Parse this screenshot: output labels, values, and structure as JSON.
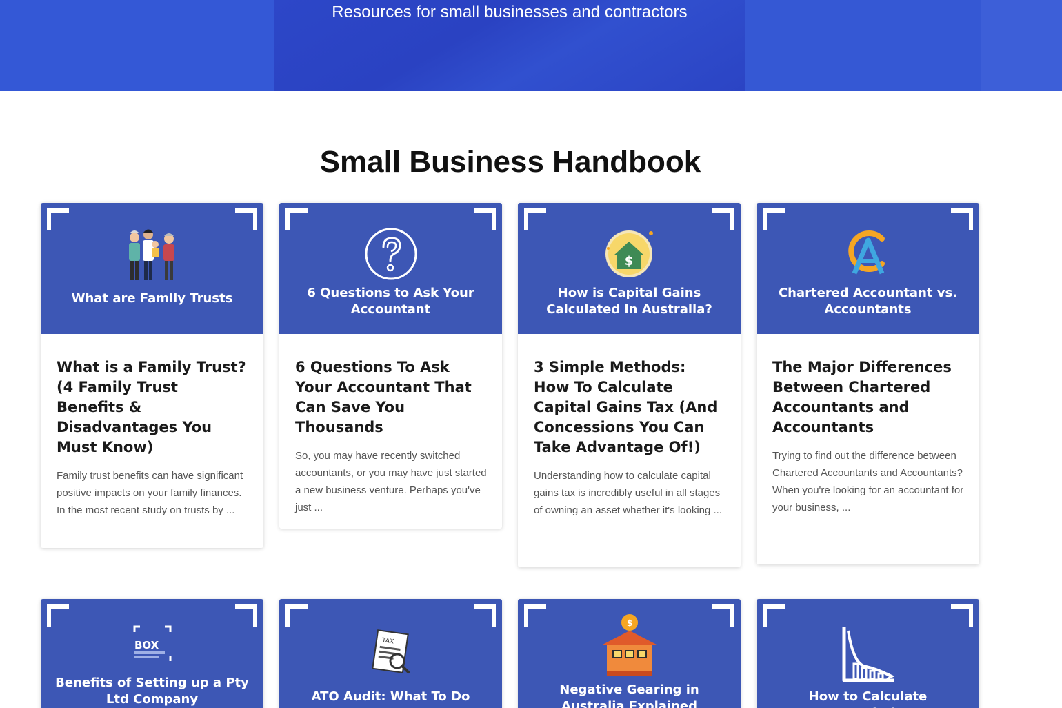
{
  "hero": {
    "subtitle": "Resources for small businesses and contractors"
  },
  "section": {
    "title": "Small Business Handbook"
  },
  "cards": [
    {
      "thumb_label": "What are Family Trusts",
      "title": "What is a Family Trust? (4 Family Trust Benefits & Disadvantages You Must Know)",
      "excerpt": "Family trust benefits can have significant positive impacts on your family finances. In the most recent study on trusts by ...",
      "icon": "family-icon"
    },
    {
      "thumb_label": "6 Questions to Ask Your Accountant",
      "title": "6 Questions To Ask Your Accountant That Can Save You Thousands",
      "excerpt": "So, you may have recently switched accountants, or you may have just started a new business venture. Perhaps you've just ...",
      "icon": "question-icon"
    },
    {
      "thumb_label": "How is Capital Gains Calculated in Australia?",
      "title": "3 Simple Methods: How To Calculate Capital Gains Tax (And Concessions You Can Take Advantage Of!)",
      "excerpt": "Understanding how to calculate capital gains tax is incredibly useful in all stages of owning an asset whether it's looking ...",
      "icon": "house-dollar-icon"
    },
    {
      "thumb_label": "Chartered Accountant vs. Accountants",
      "title": "The Major Differences Between Chartered Accountants and Accountants",
      "excerpt": "Trying to find out the difference between Chartered Accountants and Accountants? When you're looking for an accountant for your business, ...",
      "icon": "ca-logo-icon"
    },
    {
      "thumb_label": "Benefits of Setting up a Pty Ltd Company",
      "icon": "box-advisory-logo-icon",
      "logo_text": "BOX"
    },
    {
      "thumb_label": "ATO Audit: What To Do",
      "icon": "tax-document-icon",
      "doc_text": "TAX"
    },
    {
      "thumb_label": "Negative Gearing in Australia Explained",
      "icon": "house-coin-icon"
    },
    {
      "thumb_label": "How to Calculate Depreciation",
      "icon": "depreciation-chart-icon"
    }
  ],
  "colors": {
    "hero": "#2f4fd0",
    "thumb": "#3d57b5",
    "accent_orange": "#f5a623"
  }
}
